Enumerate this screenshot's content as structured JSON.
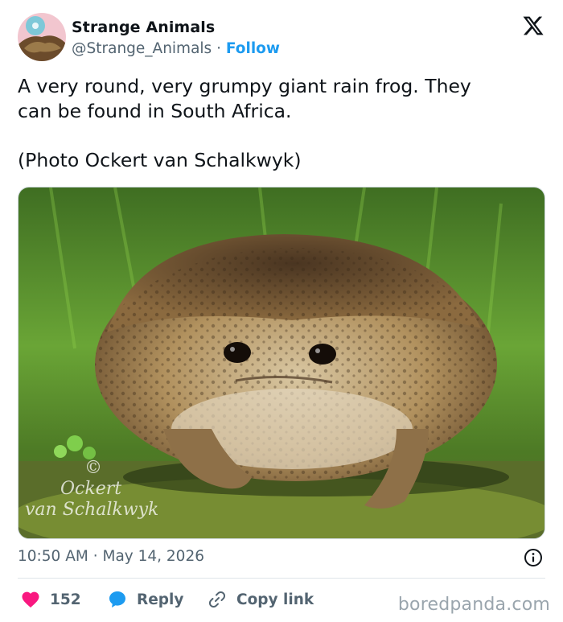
{
  "account": {
    "name": "Strange Animals",
    "handle": "@Strange_Animals",
    "separator": "·",
    "follow_label": "Follow"
  },
  "tweet": {
    "line1": "A very round, very grumpy giant rain frog. They",
    "line2": "can be found in South Africa.",
    "line3": "(Photo Ockert van Schalkwyk)"
  },
  "photo": {
    "watermark_symbol": "©",
    "watermark_line1": "Ockert",
    "watermark_line2": "van Schalkwyk"
  },
  "meta": {
    "time": "10:50 AM",
    "separator": "·",
    "date": "May 14, 2026"
  },
  "actions": {
    "like_count": "152",
    "reply_label": "Reply",
    "copy_label": "Copy link"
  },
  "site_watermark": "boredpanda.com",
  "colors": {
    "accent": "#1d9bf0",
    "like": "#f91880",
    "muted": "#536471",
    "text": "#0f1419"
  },
  "icons": {
    "logo": "x-logo-icon",
    "info": "info-icon",
    "like": "heart-icon",
    "reply": "speech-bubble-icon",
    "copy": "link-icon"
  }
}
